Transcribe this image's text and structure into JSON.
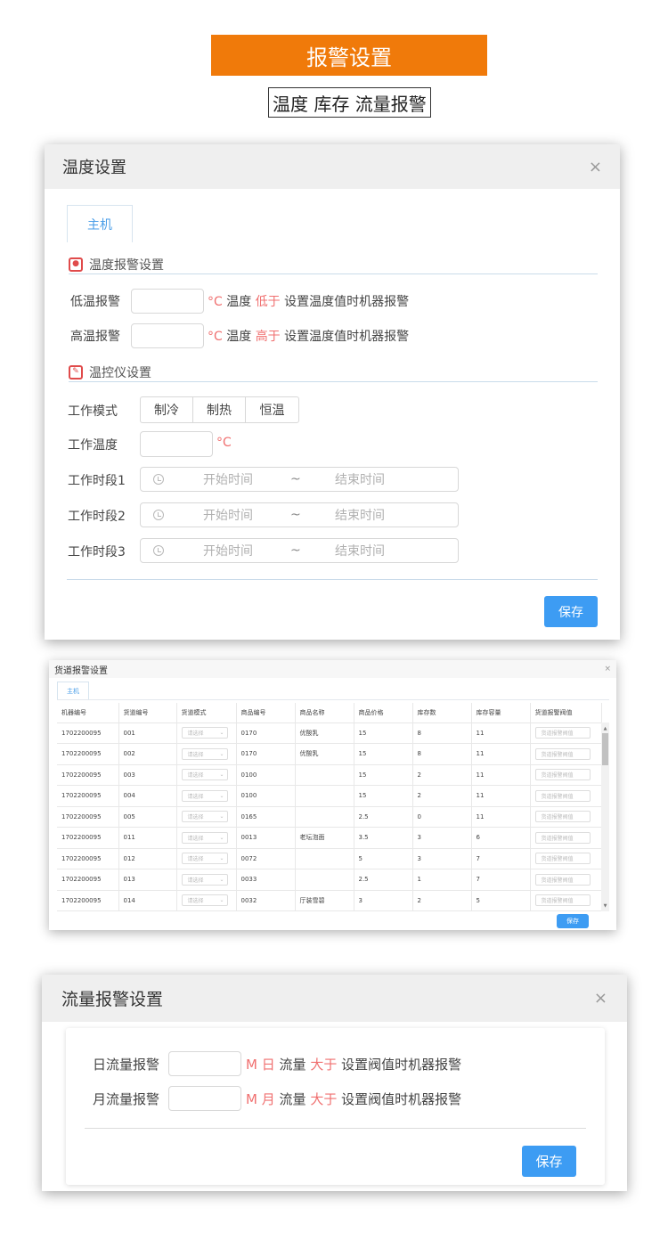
{
  "header": {
    "banner": "报警设置",
    "subtitle": "温度 库存 流量报警"
  },
  "temp_panel": {
    "title": "温度设置",
    "close": "×",
    "tab": "主机",
    "alarm_section": "温度报警设置",
    "alarm_icon": "thermometer-icon",
    "low_label": "低温报警",
    "high_label": "高温报警",
    "unit": "°C",
    "temp_word": "温度",
    "lower": "低于",
    "higher": "高于",
    "suffix": "设置温度值时机器报警",
    "controller_section": "温控仪设置",
    "controller_icon": "brush-icon",
    "mode_label": "工作模式",
    "modes": [
      "制冷",
      "制热",
      "恒温"
    ],
    "work_temp_label": "工作温度",
    "period_labels": [
      "工作时段1",
      "工作时段2",
      "工作时段3"
    ],
    "start_placeholder": "开始时间",
    "range_sep": "~",
    "end_placeholder": "结束时间",
    "save": "保存"
  },
  "inventory_panel": {
    "title": "货道报警设置",
    "close": "×",
    "tab": "主机",
    "columns": [
      "机器编号",
      "货道编号",
      "货道模式",
      "商品编号",
      "商品名称",
      "商品价格",
      "库存数",
      "库存容量",
      "货道报警阀值"
    ],
    "select_placeholder": "请选择",
    "threshold_placeholder": "货道报警阀值",
    "rows": [
      [
        "1702200095",
        "001",
        "0170",
        "优酸乳",
        "15",
        "8",
        "11"
      ],
      [
        "1702200095",
        "002",
        "0170",
        "优酸乳",
        "15",
        "8",
        "11"
      ],
      [
        "1702200095",
        "003",
        "0100",
        "",
        "15",
        "2",
        "11"
      ],
      [
        "1702200095",
        "004",
        "0100",
        "",
        "15",
        "2",
        "11"
      ],
      [
        "1702200095",
        "005",
        "0165",
        "",
        "2.5",
        "0",
        "11"
      ],
      [
        "1702200095",
        "011",
        "0013",
        "老坛泡面",
        "3.5",
        "3",
        "6"
      ],
      [
        "1702200095",
        "012",
        "0072",
        "",
        "5",
        "3",
        "7"
      ],
      [
        "1702200095",
        "013",
        "0033",
        "",
        "2.5",
        "1",
        "7"
      ],
      [
        "1702200095",
        "014",
        "0032",
        "厅装雪碧",
        "3",
        "2",
        "5"
      ]
    ],
    "save": "保存"
  },
  "flow_panel": {
    "title": "流量报警设置",
    "close": "×",
    "day_label": "日流量报警",
    "month_label": "月流量报警",
    "unit": "M",
    "day": "日",
    "month": "月",
    "flow_word": "流量",
    "greater": "大于",
    "suffix": "设置阀值时机器报警",
    "save": "保存"
  }
}
